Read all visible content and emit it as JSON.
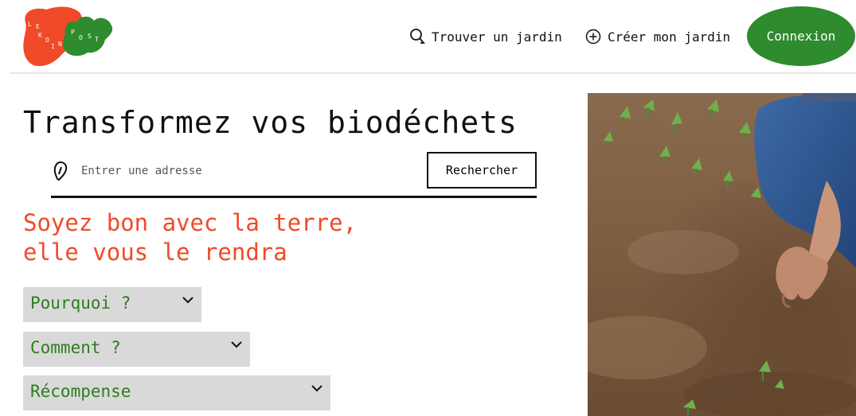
{
  "header": {
    "logo_letters": [
      "L",
      "E",
      "K",
      "O",
      "I",
      "N",
      "P",
      "O",
      "S",
      "T"
    ],
    "nav_find_label": "Trouver un jardin",
    "nav_create_label": "Créer mon jardin",
    "login_label": "Connexion",
    "colors": {
      "brand_red": "#f04a28",
      "brand_green": "#2e8b2e"
    }
  },
  "main": {
    "title": "Transformez vos biodéchets",
    "search": {
      "placeholder": "Entrer une adresse",
      "value": "",
      "button_label": "Rechercher"
    },
    "tagline_line1": "Soyez bon avec la terre,",
    "tagline_line2": "elle vous le rendra",
    "accordion": [
      {
        "label": "Pourquoi ?",
        "expanded": false
      },
      {
        "label": "Comment ?",
        "expanded": false
      },
      {
        "label": "Récompense",
        "expanded": false
      }
    ],
    "icons": {
      "find": "search-icon",
      "create": "plus-circle-icon",
      "pin": "map-pin-icon",
      "accordion": "chevron-down-icon"
    }
  }
}
